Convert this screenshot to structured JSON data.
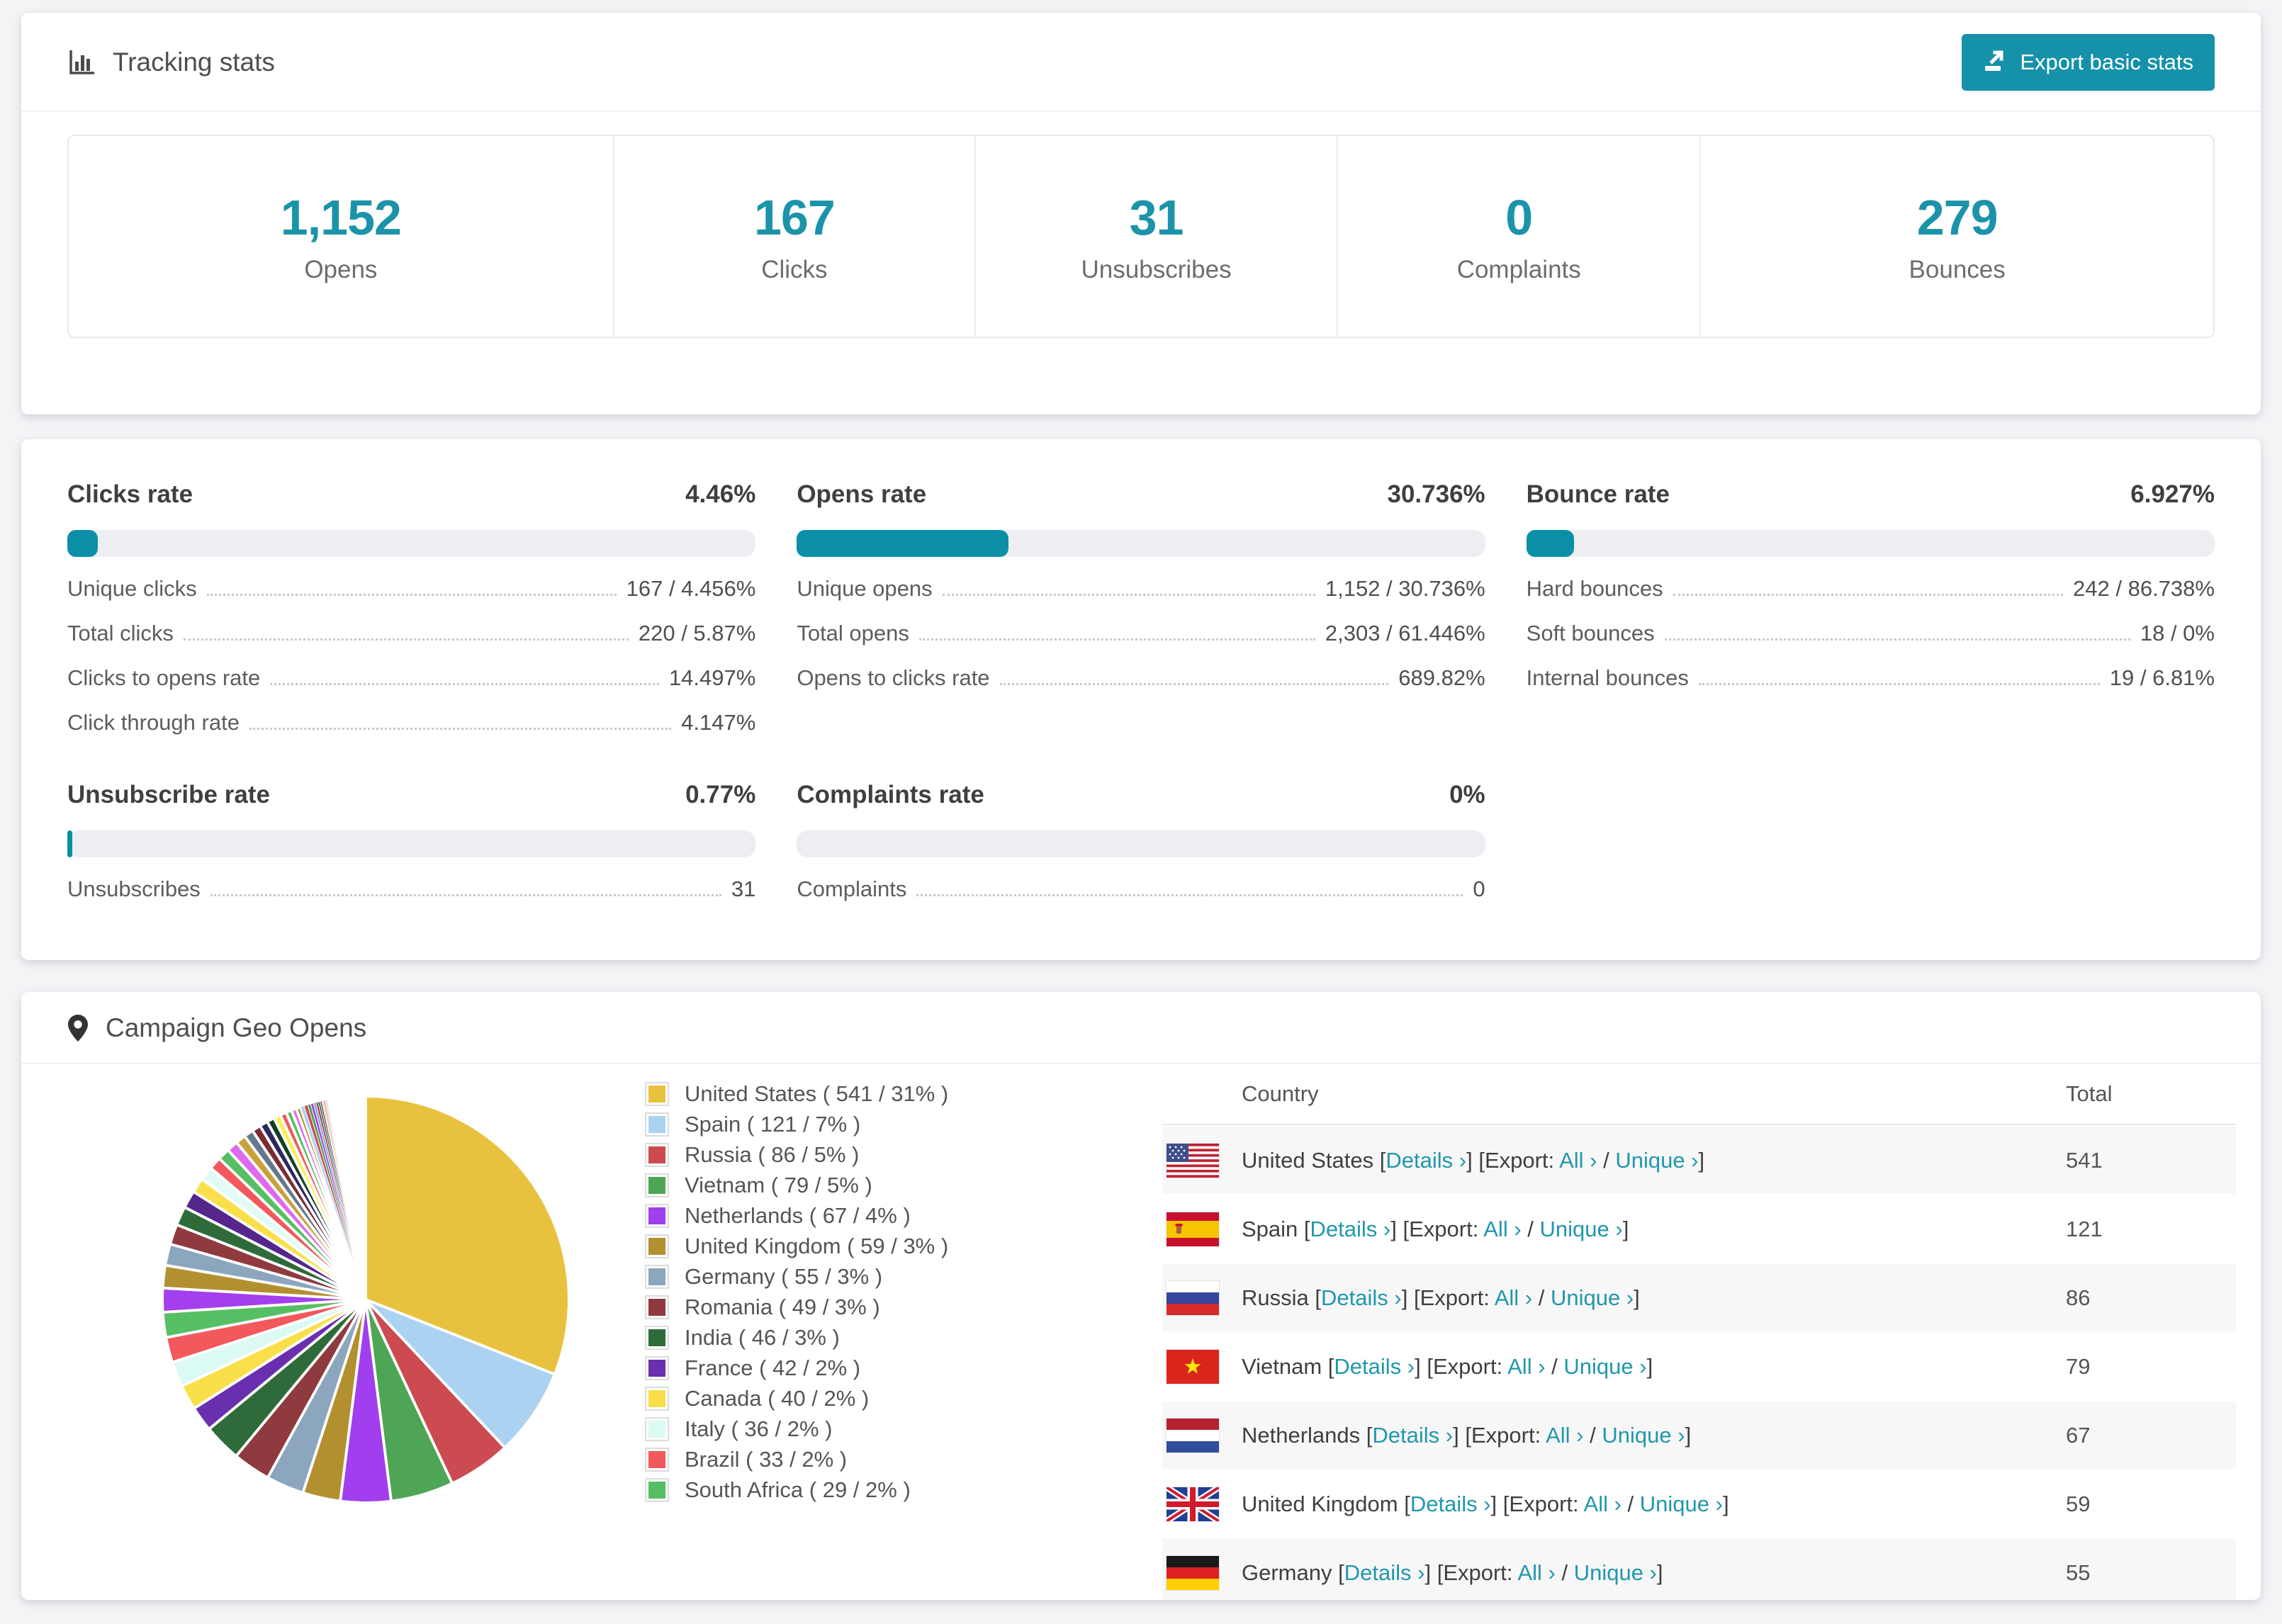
{
  "colors": {
    "accent_teal": "#1b93a9",
    "bar_fill": "#0a8fa6",
    "bar_track": "#eceef2",
    "link": "#2097ad",
    "button_bg": "#1591a9",
    "page_bg": "#f3f4f6"
  },
  "tracking": {
    "title": "Tracking stats",
    "export_button": "Export basic stats",
    "stats": [
      {
        "value": "1,152",
        "label": "Opens"
      },
      {
        "value": "167",
        "label": "Clicks"
      },
      {
        "value": "31",
        "label": "Unsubscribes"
      },
      {
        "value": "0",
        "label": "Complaints"
      },
      {
        "value": "279",
        "label": "Bounces"
      }
    ]
  },
  "rates": [
    {
      "title": "Clicks rate",
      "value": "4.46%",
      "pct": 4.46,
      "rows": [
        {
          "label": "Unique clicks",
          "value": "167 / 4.456%"
        },
        {
          "label": "Total clicks",
          "value": "220 / 5.87%"
        },
        {
          "label": "Clicks to opens rate",
          "value": "14.497%"
        },
        {
          "label": "Click through rate",
          "value": "4.147%"
        }
      ]
    },
    {
      "title": "Opens rate",
      "value": "30.736%",
      "pct": 30.736,
      "rows": [
        {
          "label": "Unique opens",
          "value": "1,152 / 30.736%"
        },
        {
          "label": "Total opens",
          "value": "2,303 / 61.446%"
        },
        {
          "label": "Opens to clicks rate",
          "value": "689.82%"
        }
      ]
    },
    {
      "title": "Bounce rate",
      "value": "6.927%",
      "pct": 6.927,
      "rows": [
        {
          "label": "Hard bounces",
          "value": "242 / 86.738%"
        },
        {
          "label": "Soft bounces",
          "value": "18 / 0%"
        },
        {
          "label": "Internal bounces",
          "value": "19 / 6.81%"
        }
      ]
    },
    {
      "title": "Unsubscribe rate",
      "value": "0.77%",
      "pct": 0.77,
      "rows": [
        {
          "label": "Unsubscribes",
          "value": "31"
        }
      ]
    },
    {
      "title": "Complaints rate",
      "value": "0%",
      "pct": 0,
      "rows": [
        {
          "label": "Complaints",
          "value": "0"
        }
      ]
    }
  ],
  "geo": {
    "title": "Campaign Geo Opens",
    "table_headers": {
      "country": "Country",
      "total": "Total"
    },
    "link_labels": {
      "details": "Details",
      "export": "Export:",
      "all": "All",
      "unique": "Unique",
      "arrow": "›"
    },
    "table_visible_rows": 7,
    "countries": [
      {
        "name": "United States",
        "flag": "us",
        "count": 541,
        "pct": 31,
        "color": "#e8c23e"
      },
      {
        "name": "Spain",
        "flag": "es",
        "count": 121,
        "pct": 7,
        "color": "#abd3f1"
      },
      {
        "name": "Russia",
        "flag": "ru",
        "count": 86,
        "pct": 5,
        "color": "#cb4b50"
      },
      {
        "name": "Vietnam",
        "flag": "vn",
        "count": 79,
        "pct": 5,
        "color": "#4fa556"
      },
      {
        "name": "Netherlands",
        "flag": "nl",
        "count": 67,
        "pct": 4,
        "color": "#a13fee"
      },
      {
        "name": "United Kingdom",
        "flag": "gb",
        "count": 59,
        "pct": 3,
        "color": "#b2902f"
      },
      {
        "name": "Germany",
        "flag": "de",
        "count": 55,
        "pct": 3,
        "color": "#8ba6bd"
      },
      {
        "name": "Romania",
        "flag": "ro",
        "count": 49,
        "pct": 3,
        "color": "#8e3a3f"
      },
      {
        "name": "India",
        "flag": "in",
        "count": 46,
        "pct": 3,
        "color": "#2f6b3a"
      },
      {
        "name": "France",
        "flag": "fr",
        "count": 42,
        "pct": 2,
        "color": "#6a2fae"
      },
      {
        "name": "Canada",
        "flag": "ca",
        "count": 40,
        "pct": 2,
        "color": "#f9e04b"
      },
      {
        "name": "Italy",
        "flag": "it",
        "count": 36,
        "pct": 2,
        "color": "#dafaf3"
      },
      {
        "name": "Brazil",
        "flag": "br",
        "count": 33,
        "pct": 2,
        "color": "#f2585c"
      },
      {
        "name": "South Africa",
        "flag": "za",
        "count": 29,
        "pct": 2,
        "color": "#57bf63"
      }
    ]
  },
  "chart_data": {
    "type": "pie",
    "title": "Campaign Geo Opens",
    "legend_position": "right",
    "start_angle_deg": -90,
    "direction": "clockwise",
    "labels": [
      "United States",
      "Spain",
      "Russia",
      "Vietnam",
      "Netherlands",
      "United Kingdom",
      "Germany",
      "Romania",
      "India",
      "France",
      "Canada",
      "Italy",
      "Brazil",
      "South Africa"
    ],
    "values": [
      541,
      121,
      86,
      79,
      67,
      59,
      55,
      49,
      46,
      42,
      40,
      36,
      33,
      29
    ],
    "pct": [
      31,
      7,
      5,
      5,
      4,
      3,
      3,
      3,
      3,
      2,
      2,
      2,
      2,
      2
    ],
    "colors": [
      "#e8c23e",
      "#abd3f1",
      "#cb4b50",
      "#4fa556",
      "#a13fee",
      "#b2902f",
      "#8ba6bd",
      "#8e3a3f",
      "#2f6b3a",
      "#6a2fae",
      "#f9e04b",
      "#dafaf3",
      "#f2585c",
      "#57bf63"
    ],
    "other_slices": {
      "comment_label": "unlabeled small countries fanning out to 12 o'clock",
      "pcts": [
        1.9,
        1.8,
        1.7,
        1.6,
        1.5,
        1.4,
        1.2,
        1.1,
        1.0,
        0.95,
        0.9,
        0.8,
        0.75,
        0.7,
        0.65,
        0.6,
        0.55,
        0.5,
        0.45,
        0.4,
        0.35,
        0.3,
        0.28,
        0.25,
        0.22,
        0.2,
        0.18,
        0.16,
        0.14,
        0.12,
        0.1,
        0.09,
        0.08,
        0.07,
        0.06,
        0.05,
        0.05,
        0.04,
        0.04,
        0.03,
        0.03,
        0.02,
        0.02
      ],
      "colors": [
        "#a43fee",
        "#b2902f",
        "#8ba6bd",
        "#8e3a3f",
        "#2f6b3a",
        "#55268b",
        "#f9e04b",
        "#e3fbf6",
        "#f2585c",
        "#57bf63",
        "#e069ed",
        "#c9a13b",
        "#64778c",
        "#7a2d33",
        "#2d275e",
        "#163f22",
        "#f6ef4e",
        "#f2585c",
        "#57bf63",
        "#e069ed",
        "#b2902f",
        "#abd3f1",
        "#cb4b50",
        "#4fa556",
        "#a43fee",
        "#8ba6bd",
        "#8e3a3f",
        "#2f6b3a",
        "#6a2fae",
        "#f9e04b",
        "#f2585c",
        "#57bf63",
        "#e069ed",
        "#c9a13b",
        "#64778c",
        "#7a2d33",
        "#2d275e",
        "#163f22",
        "#cb4b50",
        "#4fa556",
        "#a43fee",
        "#b2902f",
        "#8ba6bd"
      ]
    }
  }
}
